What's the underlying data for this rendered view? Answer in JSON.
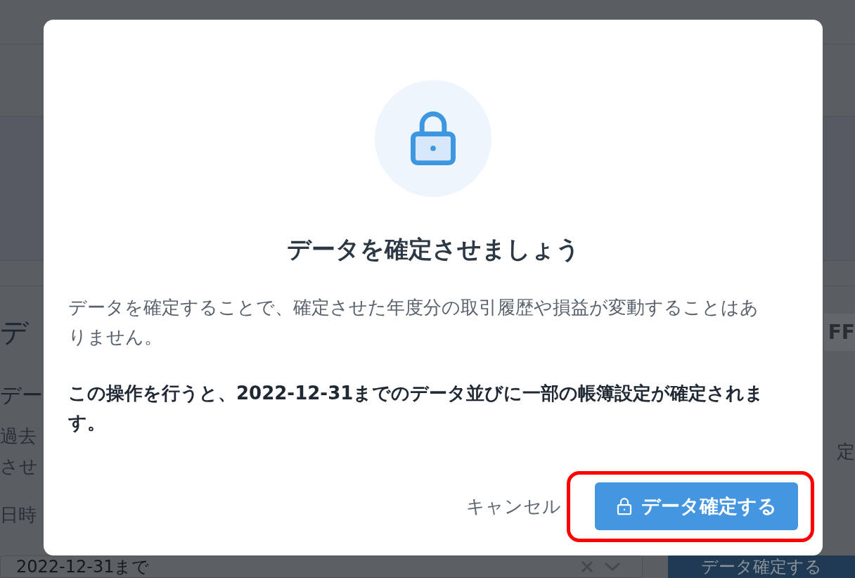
{
  "background": {
    "heading": "デ",
    "toggle_label": "FF",
    "subheading": "デー",
    "description_lines": [
      "過去",
      "させ"
    ],
    "description_right": "定",
    "field_label": "日時",
    "date_field": {
      "value": "2022-12-31まで"
    },
    "confirm_button": "データ確定する"
  },
  "dialog": {
    "title": "データを確定させましょう",
    "body": "データを確定することで、確定させた年度分の取引履歴や損益が変動することはありません。",
    "notice": "この操作を行うと、2022-12-31までのデータ並びに一部の帳簿設定が確定されます。",
    "buttons": [
      {
        "kind": "cancel",
        "label": "キャンセル",
        "highlighted": false
      },
      {
        "kind": "confirm",
        "label": "データ確定する",
        "highlighted": true
      }
    ]
  }
}
